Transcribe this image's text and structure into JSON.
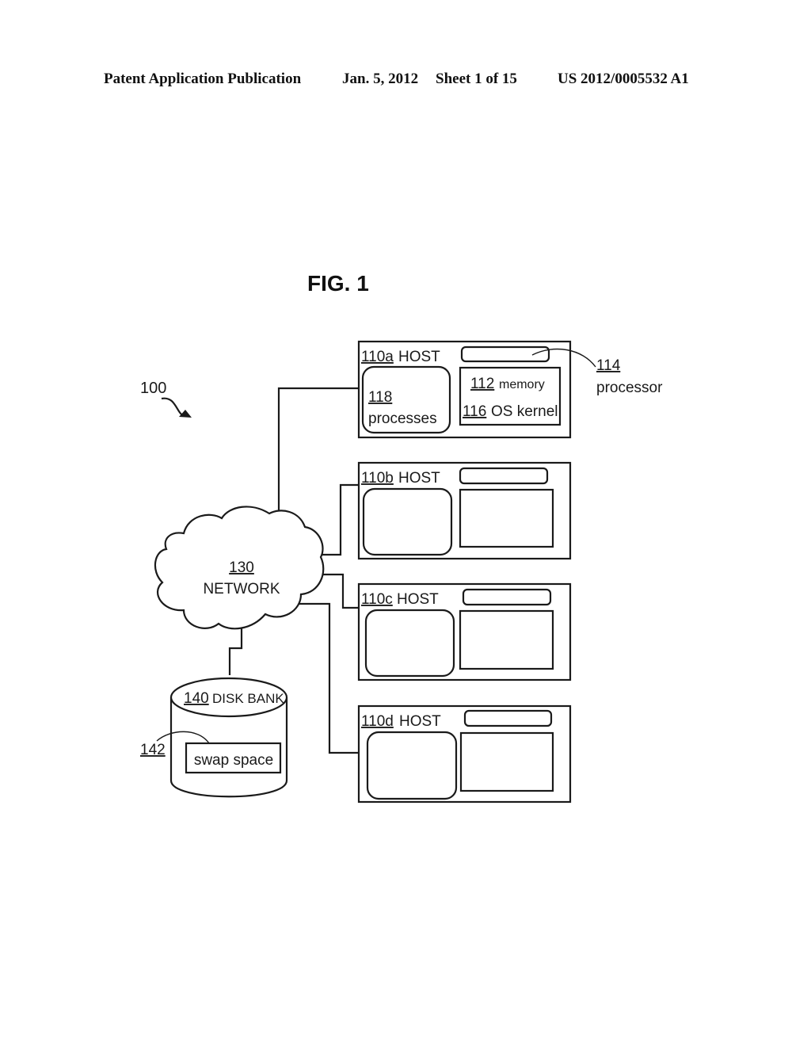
{
  "header": {
    "publication_type": "Patent Application Publication",
    "date": "Jan. 5, 2012",
    "sheet": "Sheet 1 of 15",
    "pub_number": "US 2012/0005532 A1"
  },
  "figure": {
    "title": "FIG. 1",
    "system_ref": "100",
    "network": {
      "ref": "130",
      "label": "NETWORK"
    },
    "disk_bank": {
      "ref": "140",
      "label": "DISK BANK",
      "swap_ref": "142",
      "swap_label": "swap space"
    },
    "processor_callout": {
      "ref": "114",
      "label": "processor"
    },
    "hosts": [
      {
        "ref": "110a",
        "label": "HOST",
        "processes_ref": "118",
        "processes_label": "processes",
        "memory_ref": "112",
        "memory_label": "memory",
        "kernel_ref": "116",
        "kernel_label": "OS kernel"
      },
      {
        "ref": "110b",
        "label": "HOST"
      },
      {
        "ref": "110c",
        "label": "HOST"
      },
      {
        "ref": "110d",
        "label": "HOST"
      }
    ]
  }
}
